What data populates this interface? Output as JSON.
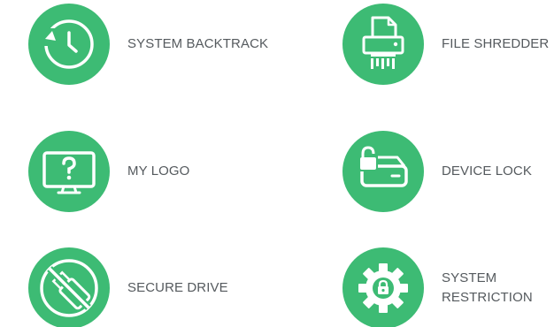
{
  "accent_color": "#3dbb74",
  "label_color": "#555a5e",
  "features": [
    {
      "label": "SYSTEM BACKTRACK",
      "icon": "clock-history-icon"
    },
    {
      "label": "FILE SHREDDER",
      "icon": "file-shredder-icon"
    },
    {
      "label": "MY LOGO",
      "icon": "monitor-question-icon"
    },
    {
      "label": "DEVICE LOCK",
      "icon": "drive-lock-icon"
    },
    {
      "label": "SECURE DRIVE",
      "icon": "usb-blocked-icon"
    },
    {
      "label_line1": "SYSTEM",
      "label_line2": "RESTRICTION",
      "icon": "gear-lock-icon"
    }
  ]
}
